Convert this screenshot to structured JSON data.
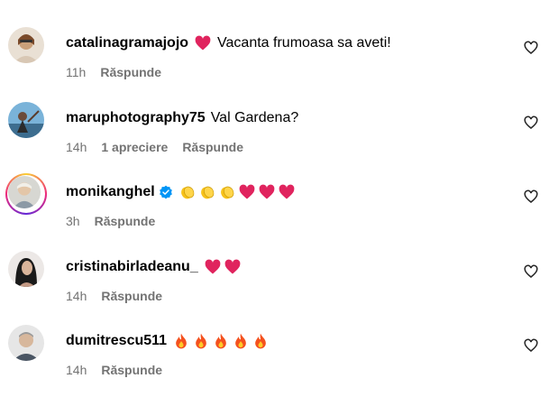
{
  "comments": [
    {
      "username": "catalinagramajojo",
      "text": "Vacanta frumoasa sa aveti!",
      "emoji_prefix": [
        "red-heart"
      ],
      "emoji_suffix": [],
      "time": "11h",
      "likes": "",
      "reply_label": "Răspunde",
      "verified": false,
      "story_ring": false
    },
    {
      "username": "maruphotography75",
      "text": "Val Gardena?",
      "emoji_prefix": [],
      "emoji_suffix": [],
      "time": "14h",
      "likes": "1 apreciere",
      "reply_label": "Răspunde",
      "verified": false,
      "story_ring": false
    },
    {
      "username": "monikanghel",
      "text": "",
      "emoji_prefix": [],
      "emoji_suffix": [
        "clapping-hands",
        "clapping-hands",
        "clapping-hands",
        "red-heart",
        "red-heart",
        "red-heart"
      ],
      "time": "3h",
      "likes": "",
      "reply_label": "Răspunde",
      "verified": true,
      "story_ring": true
    },
    {
      "username": "cristinabirladeanu_",
      "text": "",
      "emoji_prefix": [],
      "emoji_suffix": [
        "red-heart",
        "red-heart"
      ],
      "time": "14h",
      "likes": "",
      "reply_label": "Răspunde",
      "verified": false,
      "story_ring": false
    },
    {
      "username": "dumitrescu511",
      "text": "",
      "emoji_prefix": [],
      "emoji_suffix": [
        "fire",
        "fire",
        "fire",
        "fire",
        "fire"
      ],
      "time": "14h",
      "likes": "",
      "reply_label": "Răspunde",
      "verified": false,
      "story_ring": false
    }
  ],
  "colors": {
    "secondary_text": "#737373",
    "verified_blue": "#0095f6",
    "heart_red": "#e0245e"
  }
}
